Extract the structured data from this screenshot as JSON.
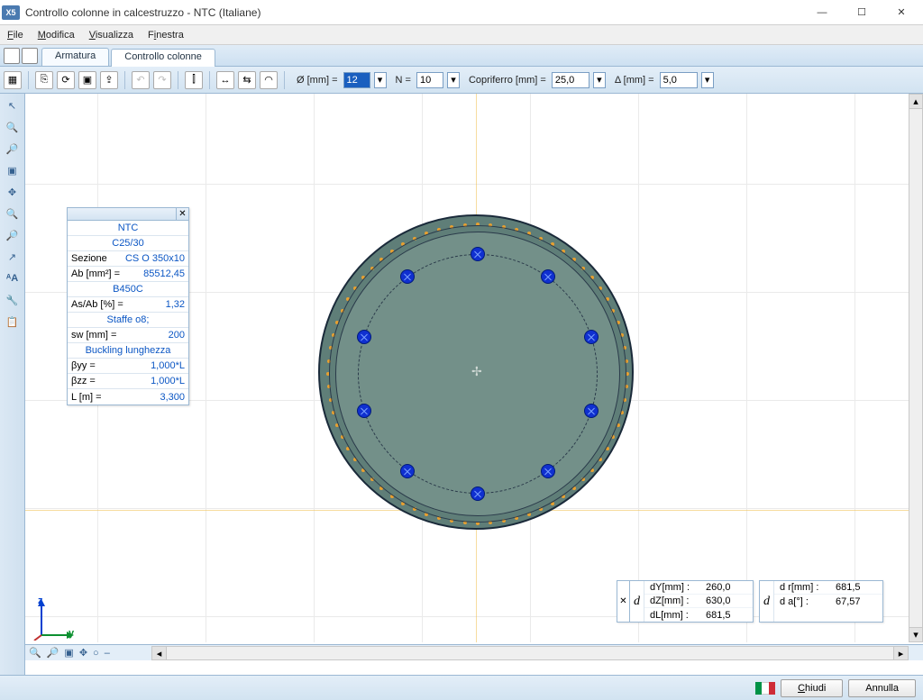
{
  "title": "Controllo colonne in calcestruzzo - NTC (Italiane)",
  "menus": {
    "file": "File",
    "modifica": "Modifica",
    "visualizza": "Visualizza",
    "finestra": "Finestra"
  },
  "tabs": {
    "armatura": "Armatura",
    "controllo": "Controllo colonne"
  },
  "toolbar": {
    "diam_label": "Ø [mm] =",
    "diam_value": "12",
    "n_label": "N =",
    "n_value": "10",
    "cover_label": "Copriferro [mm] =",
    "cover_value": "25,0",
    "delta_label": "Δ [mm] =",
    "delta_value": "5,0"
  },
  "info": {
    "ntc": "NTC",
    "concrete": "C25/30",
    "sezione_k": "Sezione",
    "sezione_v": "CS O 350x10",
    "ab_k": "Ab [mm²] =",
    "ab_v": "85512,45",
    "steel": "B450C",
    "asab_k": "As/Ab [%] =",
    "asab_v": "1,32",
    "staffe": "Staffe o8;",
    "sw_k": "sw [mm] =",
    "sw_v": "200",
    "buckling": "Buckling lunghezza",
    "byy_k": "βyy =",
    "byy_v": "1,000*L",
    "bzz_k": "βzz =",
    "bzz_v": "1,000*L",
    "l_k": "L [m] =",
    "l_v": "3,300"
  },
  "coords": {
    "dy_k": "dY[mm] :",
    "dy_v": "260,0",
    "dz_k": "dZ[mm] :",
    "dz_v": "630,0",
    "dl_k": "dL[mm] :",
    "dl_v": "681,5",
    "dr_k": "d r[mm] :",
    "dr_v": "681,5",
    "da_k": "d   a[°] :",
    "da_v": "67,57"
  },
  "axis": {
    "z": "z",
    "y": "y"
  },
  "buttons": {
    "chiudi": "Chiudi",
    "annulla": "Annulla"
  },
  "chart_data": {
    "section": {
      "shape": "circle",
      "outer_diameter_mm": 350,
      "cover_mm": 25.0
    },
    "rebars": {
      "count": 10,
      "diameter_mm": 12,
      "arrangement": "evenly-spaced-circle"
    },
    "stirrups": {
      "diameter_mm": 8,
      "spacing_mm": 200
    }
  }
}
